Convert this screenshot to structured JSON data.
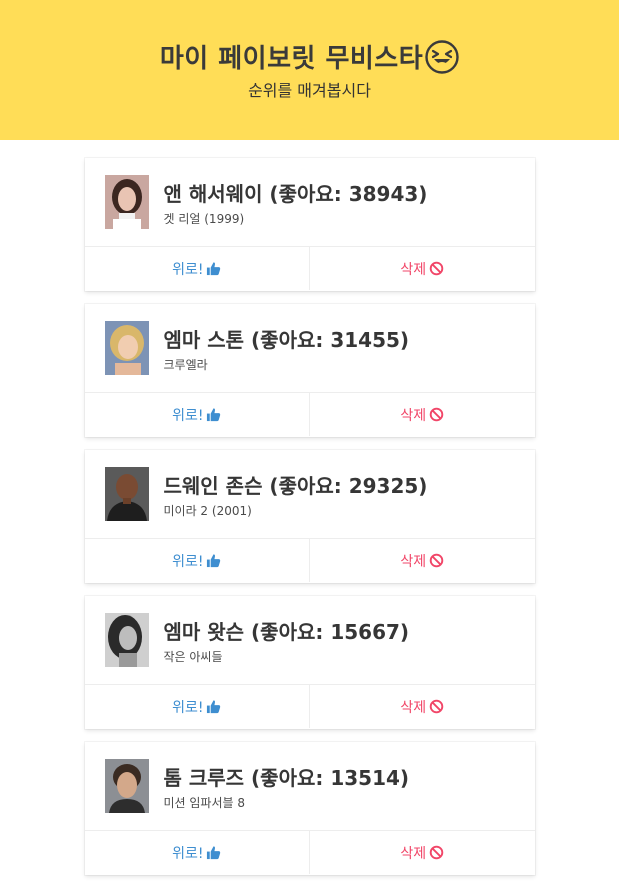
{
  "header": {
    "title": "마이 페이보릿 무비스타",
    "emoji": "squinting-face-with-tongue-icon",
    "subtitle": "순위를 매겨봅시다"
  },
  "colors": {
    "header_bg": "#FFDD57",
    "cheer": "#3e8ed0",
    "delete": "#f14668"
  },
  "stars": [
    {
      "title": "앤 해서웨이 (좋아요: 38943)",
      "movie": "겟 리얼 (1999)",
      "avatar": "anne-hathaway-photo",
      "cheer_label": "위로!",
      "delete_label": "삭제"
    },
    {
      "title": "엠마 스톤 (좋아요: 31455)",
      "movie": "크루엘라",
      "avatar": "emma-stone-photo",
      "cheer_label": "위로!",
      "delete_label": "삭제"
    },
    {
      "title": "드웨인 존슨 (좋아요: 29325)",
      "movie": "미이라 2 (2001)",
      "avatar": "dwayne-johnson-photo",
      "cheer_label": "위로!",
      "delete_label": "삭제"
    },
    {
      "title": "엠마 왓슨 (좋아요: 15667)",
      "movie": "작은 아씨들",
      "avatar": "emma-watson-photo",
      "cheer_label": "위로!",
      "delete_label": "삭제"
    },
    {
      "title": "톰 크루즈 (좋아요: 13514)",
      "movie": "미션 임파서블 8",
      "avatar": "tom-cruise-photo",
      "cheer_label": "위로!",
      "delete_label": "삭제"
    }
  ]
}
